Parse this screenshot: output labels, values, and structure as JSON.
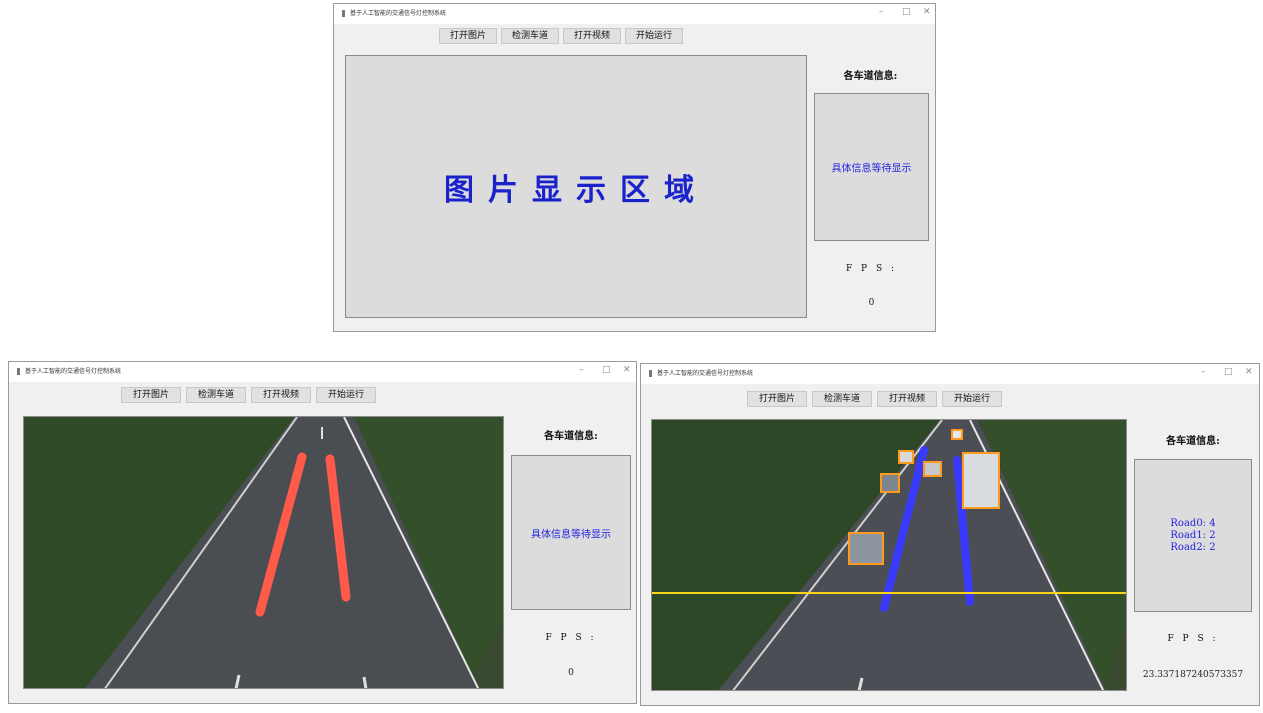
{
  "app": {
    "title": "基于人工智能的交通信号灯控制系统"
  },
  "window_controls": {
    "minimize": "–",
    "maximize": "□",
    "close": "✕"
  },
  "toolbar": {
    "open_image": "打开图片",
    "detect_lanes": "检测车道",
    "open_video": "打开视频",
    "start_run": "开始运行"
  },
  "display": {
    "placeholder": "图片显示区域"
  },
  "sidebar": {
    "title": "各车道信息:",
    "info_placeholder": "具体信息等待显示",
    "fps_label": "F P S :"
  },
  "windows": {
    "initial": {
      "fps_value": "0"
    },
    "lane_detect": {
      "fps_value": "0"
    },
    "running": {
      "fps_value": "23.337187240573357",
      "road_info": [
        "Road0: 4",
        "Road1: 2",
        "Road2: 2"
      ]
    }
  },
  "colors": {
    "accent_blue": "#1a22cc",
    "lane_red": "#ff5a4a",
    "lane_blue": "#3a3aff",
    "count_line": "#ffd21a",
    "bbox": "#ff9a1e"
  }
}
